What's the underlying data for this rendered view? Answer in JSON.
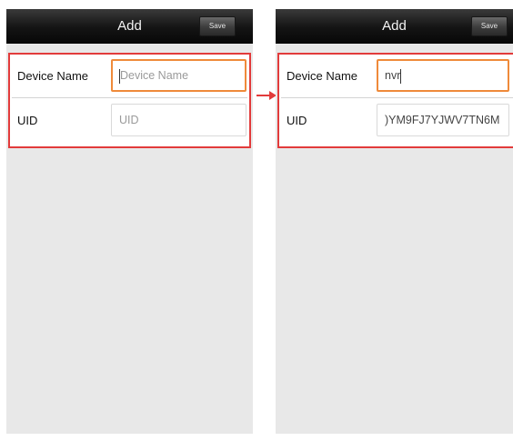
{
  "screens": [
    {
      "title": "Add",
      "save_label": "Save",
      "device_name_label": "Device Name",
      "device_name_placeholder": "Device Name",
      "uid_label": "UID",
      "uid_placeholder": "UID"
    },
    {
      "title": "Add",
      "save_label": "Save",
      "device_name_label": "Device Name",
      "device_name_value": "nvr",
      "uid_label": "UID",
      "uid_value": ")YM9FJ7YJWV7TN6M"
    }
  ],
  "colors": {
    "highlight_border": "#e23b3b",
    "focus_border": "#ef8a3a",
    "titlebar": "#111111",
    "background": "#e8e8e8"
  }
}
